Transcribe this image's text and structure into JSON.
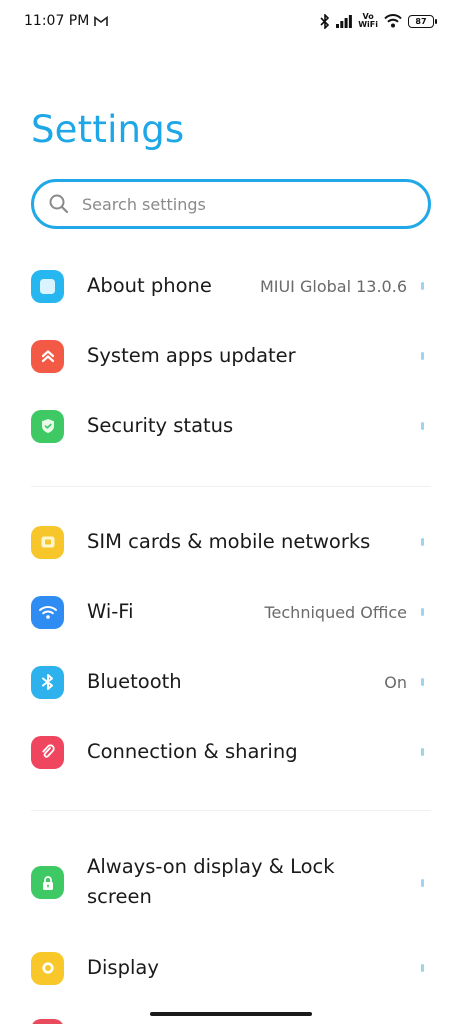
{
  "status_bar": {
    "time": "11:07 PM",
    "vowifi_top": "Vo",
    "vowifi_bottom": "WiFi",
    "battery": "87"
  },
  "title": "Settings",
  "search": {
    "placeholder": "Search settings"
  },
  "colors": {
    "accent": "#1ea7e6"
  },
  "groups": [
    [
      {
        "label": "About phone",
        "value": "MIUI Global 13.0.6",
        "icon": "phone-icon",
        "color": "#26b6f0"
      },
      {
        "label": "System apps updater",
        "value": "",
        "icon": "double-chevron-up-icon",
        "color": "#f35a45"
      },
      {
        "label": "Security status",
        "value": "",
        "icon": "shield-check-icon",
        "color": "#3ec964"
      }
    ],
    [
      {
        "label": "SIM cards & mobile networks",
        "value": "",
        "icon": "sim-card-icon",
        "color": "#f6c62a"
      },
      {
        "label": "Wi-Fi",
        "value": "Techniqued Office",
        "icon": "wifi-icon",
        "color": "#2f8cf2"
      },
      {
        "label": "Bluetooth",
        "value": "On",
        "icon": "bluetooth-icon",
        "color": "#2eb2ee"
      },
      {
        "label": "Connection & sharing",
        "value": "",
        "icon": "link-icon",
        "color": "#f0455e"
      }
    ],
    [
      {
        "label": "Always-on display & Lock screen",
        "value": "",
        "icon": "lock-icon",
        "color": "#3ec964"
      },
      {
        "label": "Display",
        "value": "",
        "icon": "sun-icon",
        "color": "#f8c82b"
      }
    ]
  ]
}
